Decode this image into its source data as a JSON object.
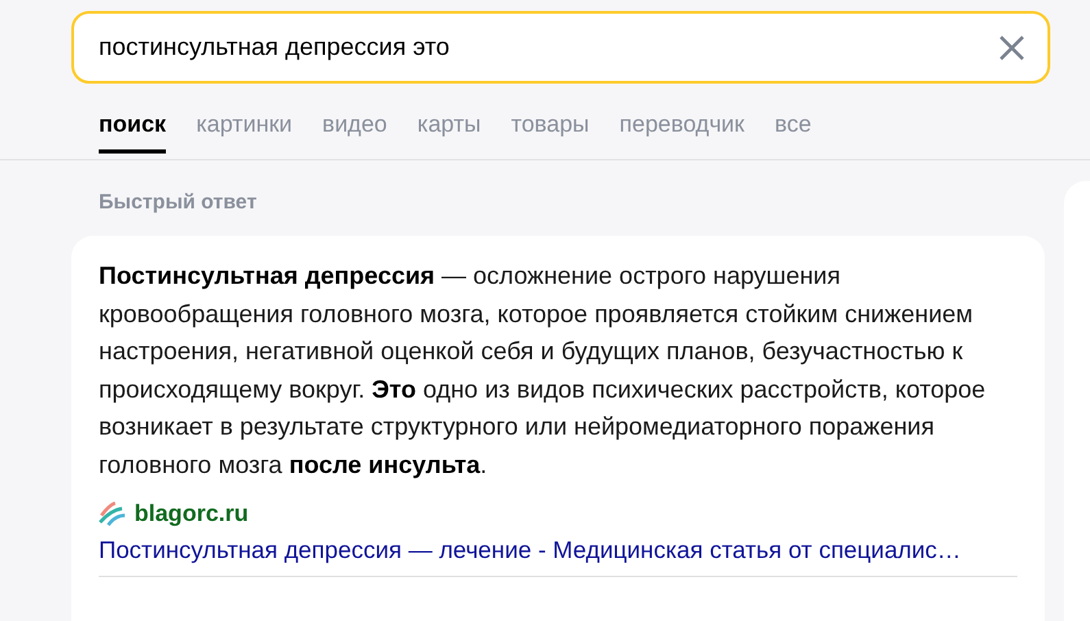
{
  "search": {
    "value": "постинсультная депрессия это"
  },
  "tabs": [
    {
      "label": "поиск",
      "selected": true
    },
    {
      "label": "картинки",
      "selected": false
    },
    {
      "label": "видео",
      "selected": false
    },
    {
      "label": "карты",
      "selected": false
    },
    {
      "label": "товары",
      "selected": false
    },
    {
      "label": "переводчик",
      "selected": false
    },
    {
      "label": "все",
      "selected": false
    }
  ],
  "quick_answer": {
    "heading": "Быстрый ответ",
    "text": "**Постинсультная депрессия** — осложнение острого нарушения кровообращения головного мозга, которое проявляется стойким снижением настроения, негативной оценкой себя и будущих планов, безучастностью к происходящему вокруг. **Это** одно из видов психических расстройств, которое возникает в результате структурного или нейромедиаторного поражения головного мозга **после инсульта**.",
    "source": "blagorc.ru",
    "link": "Постинсультная депрессия — лечение - Медицинская статья от специалис…"
  }
}
